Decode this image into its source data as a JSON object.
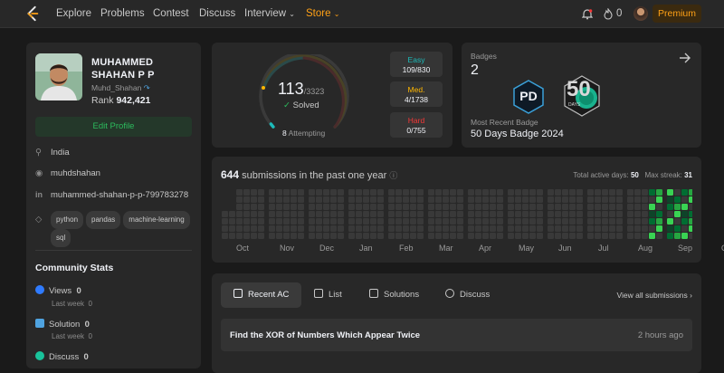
{
  "nav": {
    "items": [
      "Explore",
      "Problems",
      "Contest",
      "Discuss",
      "Interview",
      "Store"
    ],
    "streak_count": "0",
    "premium_label": "Premium"
  },
  "profile": {
    "name": "MUHAMMED SHAHAN P P",
    "username": "Muhd_Shahan",
    "rank_label": "Rank",
    "rank_value": "942,421",
    "edit_label": "Edit Profile",
    "location": "India",
    "github": "muhdshahan",
    "linkedin": "muhammed-shahan-p-p-799783278",
    "skills": [
      "python",
      "pandas",
      "machine-learning",
      "sql"
    ]
  },
  "community": {
    "title": "Community Stats",
    "stats": [
      {
        "label": "Views",
        "value": "0",
        "sub": "Last week",
        "sub_value": "0",
        "color": "#2f7bff"
      },
      {
        "label": "Solution",
        "value": "0",
        "sub": "Last week",
        "sub_value": "0",
        "color": "#4fa3e0"
      },
      {
        "label": "Discuss",
        "value": "0",
        "color": "#19c39b"
      }
    ]
  },
  "solved": {
    "count": "113",
    "total": "/3323",
    "label": "Solved",
    "attempting_count": "8",
    "attempting_label": "Attempting",
    "difficulties": [
      {
        "label": "Easy",
        "value": "109/830",
        "color": "#1cbbba"
      },
      {
        "label": "Med.",
        "value": "4/1738",
        "color": "#ffb700"
      },
      {
        "label": "Hard",
        "value": "0/755",
        "color": "#f63737"
      }
    ]
  },
  "badges": {
    "title": "Badges",
    "count": "2",
    "recent_label": "Most Recent Badge",
    "recent_name": "50 Days Badge 2024",
    "badge_pd_text": "PD",
    "badge_days_num": "50",
    "badge_days_text": "DAYS"
  },
  "submissions": {
    "count": "644",
    "text": "submissions in the past one year",
    "active_label": "Total active days:",
    "active_value": "50",
    "streak_label": "Max streak:",
    "streak_value": "31",
    "months": [
      "Oct",
      "Nov",
      "Dec",
      "Jan",
      "Feb",
      "Mar",
      "Apr",
      "May",
      "Jun",
      "Jul",
      "Aug",
      "Sep",
      "Oct"
    ]
  },
  "recent": {
    "tabs": [
      "Recent AC",
      "List",
      "Solutions",
      "Discuss"
    ],
    "view_all": "View all submissions",
    "items": [
      {
        "title": "Find the XOR of Numbers Which Appear Twice",
        "time": "2 hours ago"
      }
    ]
  }
}
